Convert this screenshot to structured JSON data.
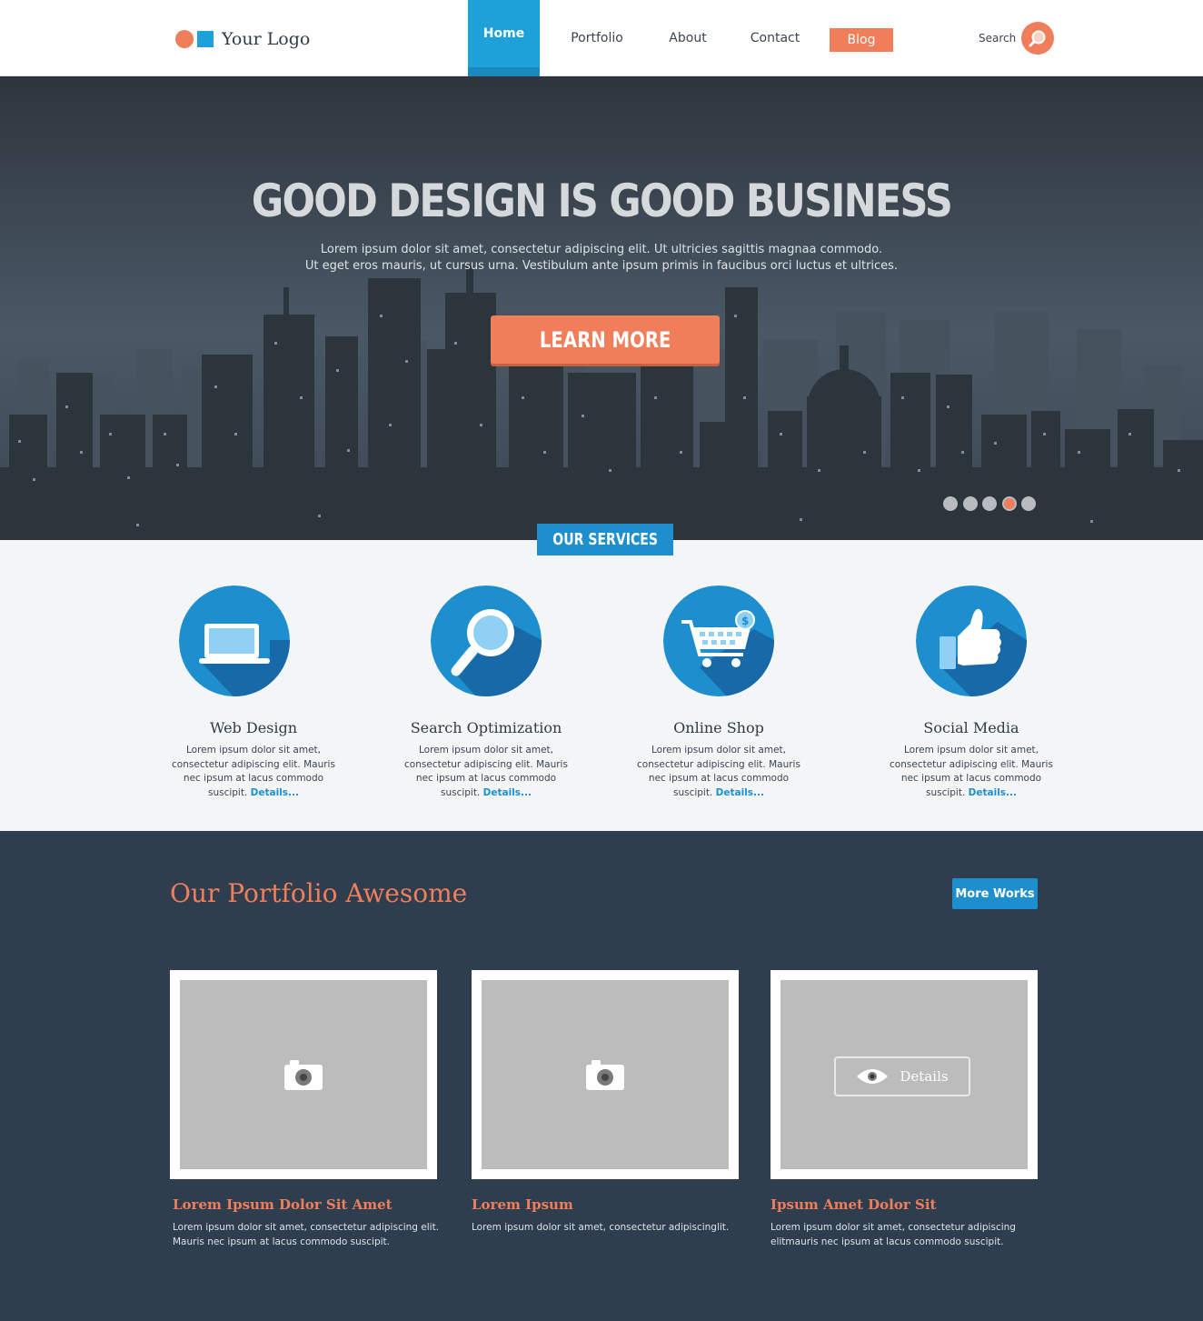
{
  "header": {
    "logo_text": "Your Logo",
    "nav": {
      "home": "Home",
      "portfolio": "Portfolio",
      "about": "About",
      "contact": "Contact",
      "blog": "Blog"
    },
    "search_label": "Search"
  },
  "hero": {
    "title": "GOOD DESIGN IS GOOD BUSINESS",
    "text_line1": "Lorem ipsum dolor sit amet, consectetur adipiscing elit. Ut ultricies sagittis magnaa commodo.",
    "text_line2": "Ut eget eros mauris, ut cursus urna. Vestibulum ante ipsum primis in faucibus orci luctus et ultrices.",
    "button": "LEARN MORE",
    "slides": 5,
    "active_slide": 4
  },
  "services": {
    "badge": "OUR SERVICES",
    "details_label": "Details...",
    "items": [
      {
        "title": "Web Design",
        "desc": "Lorem ipsum dolor sit amet, consectetur adipiscing elit. Mauris nec ipsum at lacus commodo suscipit.",
        "icon": "laptop-icon"
      },
      {
        "title": "Search Optimization",
        "desc": "Lorem ipsum dolor sit amet, consectetur adipiscing elit. Mauris nec ipsum at lacus commodo suscipit.",
        "icon": "magnifier-icon"
      },
      {
        "title": "Online Shop",
        "desc": "Lorem ipsum dolor sit amet, consectetur adipiscing elit. Mauris nec ipsum at lacus commodo suscipit.",
        "icon": "shopping-cart-icon"
      },
      {
        "title": "Social Media",
        "desc": "Lorem ipsum dolor sit amet, consectetur adipiscing elit. Mauris nec ipsum at lacus commodo suscipit.",
        "icon": "thumbs-up-icon"
      }
    ]
  },
  "portfolio": {
    "title": "Our Portfolio Awesome",
    "more_button": "More Works",
    "details_label": "Details",
    "items": [
      {
        "title": "Lorem Ipsum Dolor Sit Amet",
        "text": "Lorem ipsum dolor sit amet, consectetur adipiscing elit. Mauris nec ipsum at lacus commodo suscipit."
      },
      {
        "title": "Lorem Ipsum",
        "text": "Lorem ipsum dolor sit amet, consectetur adipiscinglit."
      },
      {
        "title": "Ipsum Amet Dolor Sit",
        "text": "Lorem ipsum dolor sit amet, consectetur adipiscing elitmauris nec ipsum at lacus commodo suscipit."
      }
    ]
  },
  "colors": {
    "accent_orange": "#f07e5a",
    "accent_blue": "#1da1d8",
    "dark_navy": "#2e3e4e"
  }
}
